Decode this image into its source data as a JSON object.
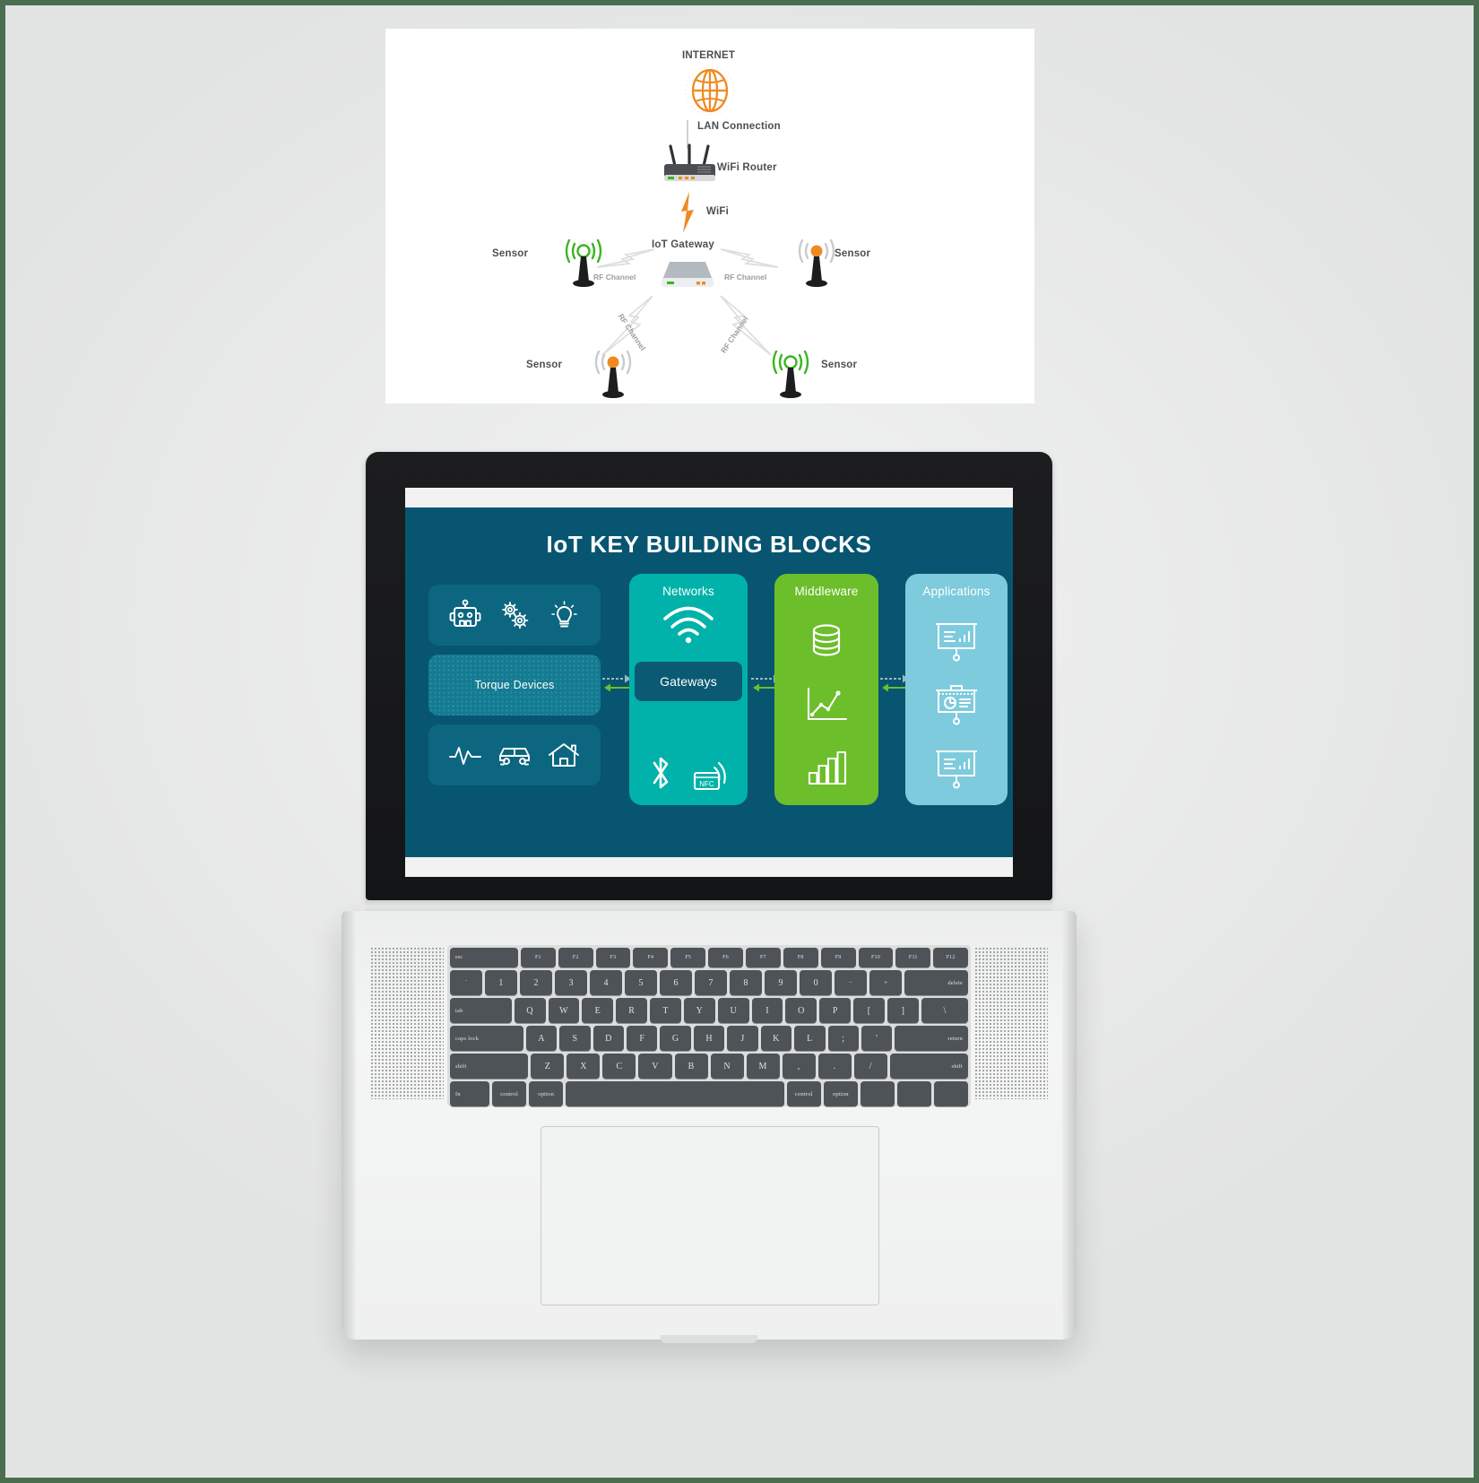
{
  "page": {
    "background_color": "#e2e3e3",
    "border_color": "#4a6e50"
  },
  "diagram": {
    "name": "iot-network-topology",
    "background_color": "#ffffff",
    "nodes": [
      {
        "id": "internet",
        "label": "INTERNET",
        "icon": "globe-icon",
        "color": "#ef8a22"
      },
      {
        "id": "router",
        "label": "WiFi Router",
        "icon": "wifi-router-icon",
        "color": "#3f4245"
      },
      {
        "id": "gateway",
        "label": "IoT Gateway",
        "icon": "gateway-device-icon",
        "color": "#b9bec2"
      },
      {
        "id": "sensor-left-top",
        "label": "Sensor",
        "icon": "antenna-icon",
        "signal_color": "#3cb521"
      },
      {
        "id": "sensor-right-top",
        "label": "Sensor",
        "icon": "antenna-icon",
        "signal_color": "#ef8a22"
      },
      {
        "id": "sensor-left-bottom",
        "label": "Sensor",
        "icon": "antenna-icon",
        "signal_color": "#ef8a22"
      },
      {
        "id": "sensor-right-bottom",
        "label": "Sensor",
        "icon": "antenna-icon",
        "signal_color": "#3cb521"
      }
    ],
    "links": [
      {
        "id": "lan",
        "label": "LAN Connection",
        "style": "solid-line"
      },
      {
        "id": "wifi",
        "label": "WiFi",
        "style": "orange-bolt"
      },
      {
        "id": "rf-1",
        "label": "RF Channel",
        "style": "grey-bolt"
      },
      {
        "id": "rf-2",
        "label": "RF Channel",
        "style": "grey-bolt"
      },
      {
        "id": "rf-3",
        "label": "RF Channel",
        "style": "grey-bolt"
      },
      {
        "id": "rf-4",
        "label": "RF Channel",
        "style": "grey-bolt"
      }
    ]
  },
  "laptop": {
    "name": "macbook-mockup",
    "slide": {
      "title": "IoT KEY BUILDING BLOCKS",
      "background_color": "#075571",
      "columns": [
        {
          "id": "devices",
          "heading": "",
          "card_color": "#0c6680",
          "center_label": "Torque Devices",
          "center_color": "#137b92",
          "icons_top": [
            "robot-icon",
            "gears-icon",
            "lightbulb-icon"
          ],
          "icons_bottom": [
            "pulse-wave-icon",
            "car-icon",
            "house-icon"
          ]
        },
        {
          "id": "networks",
          "heading": "Networks",
          "color": "#00b2a9",
          "center_label": "Gateways",
          "center_color": "#0b5a73",
          "icons_top": [
            "wifi-icon"
          ],
          "icons_bottom": [
            "bluetooth-icon",
            "nfc-icon"
          ]
        },
        {
          "id": "middleware",
          "heading": "Middleware",
          "color": "#6cbe2b",
          "icons": [
            "database-icon",
            "line-chart-icon",
            "bar-chart-icon"
          ]
        },
        {
          "id": "applications",
          "heading": "Applications",
          "color": "#7ecbdd",
          "icons": [
            "presentation-chart-icon",
            "presentation-pie-icon",
            "presentation-report-icon"
          ]
        }
      ],
      "arrow_forward_color": "#9fb6bd",
      "arrow_back_color": "#6cbe2b"
    },
    "keyboard": {
      "function_row": [
        "esc",
        "F1",
        "F2",
        "F3",
        "F4",
        "F5",
        "F6",
        "F7",
        "F8",
        "F9",
        "F10",
        "F11",
        "F12"
      ],
      "number_row": [
        "`",
        "1",
        "2",
        "3",
        "4",
        "5",
        "6",
        "7",
        "8",
        "9",
        "0",
        "−",
        "+",
        "delete"
      ],
      "top_row": [
        "tab",
        "Q",
        "W",
        "E",
        "R",
        "T",
        "Y",
        "U",
        "I",
        "O",
        "P",
        "[",
        "]",
        "\\"
      ],
      "home_row": [
        "caps lock",
        "A",
        "S",
        "D",
        "F",
        "G",
        "H",
        "J",
        "K",
        "L",
        ";",
        "'",
        "return"
      ],
      "bottom_row": [
        "shift",
        "Z",
        "X",
        "C",
        "V",
        "B",
        "N",
        "M",
        ",",
        ".",
        "/",
        "shift"
      ],
      "modifier_row": [
        "fn",
        "control",
        "option",
        "",
        "control",
        "option",
        "",
        "",
        ""
      ]
    }
  }
}
